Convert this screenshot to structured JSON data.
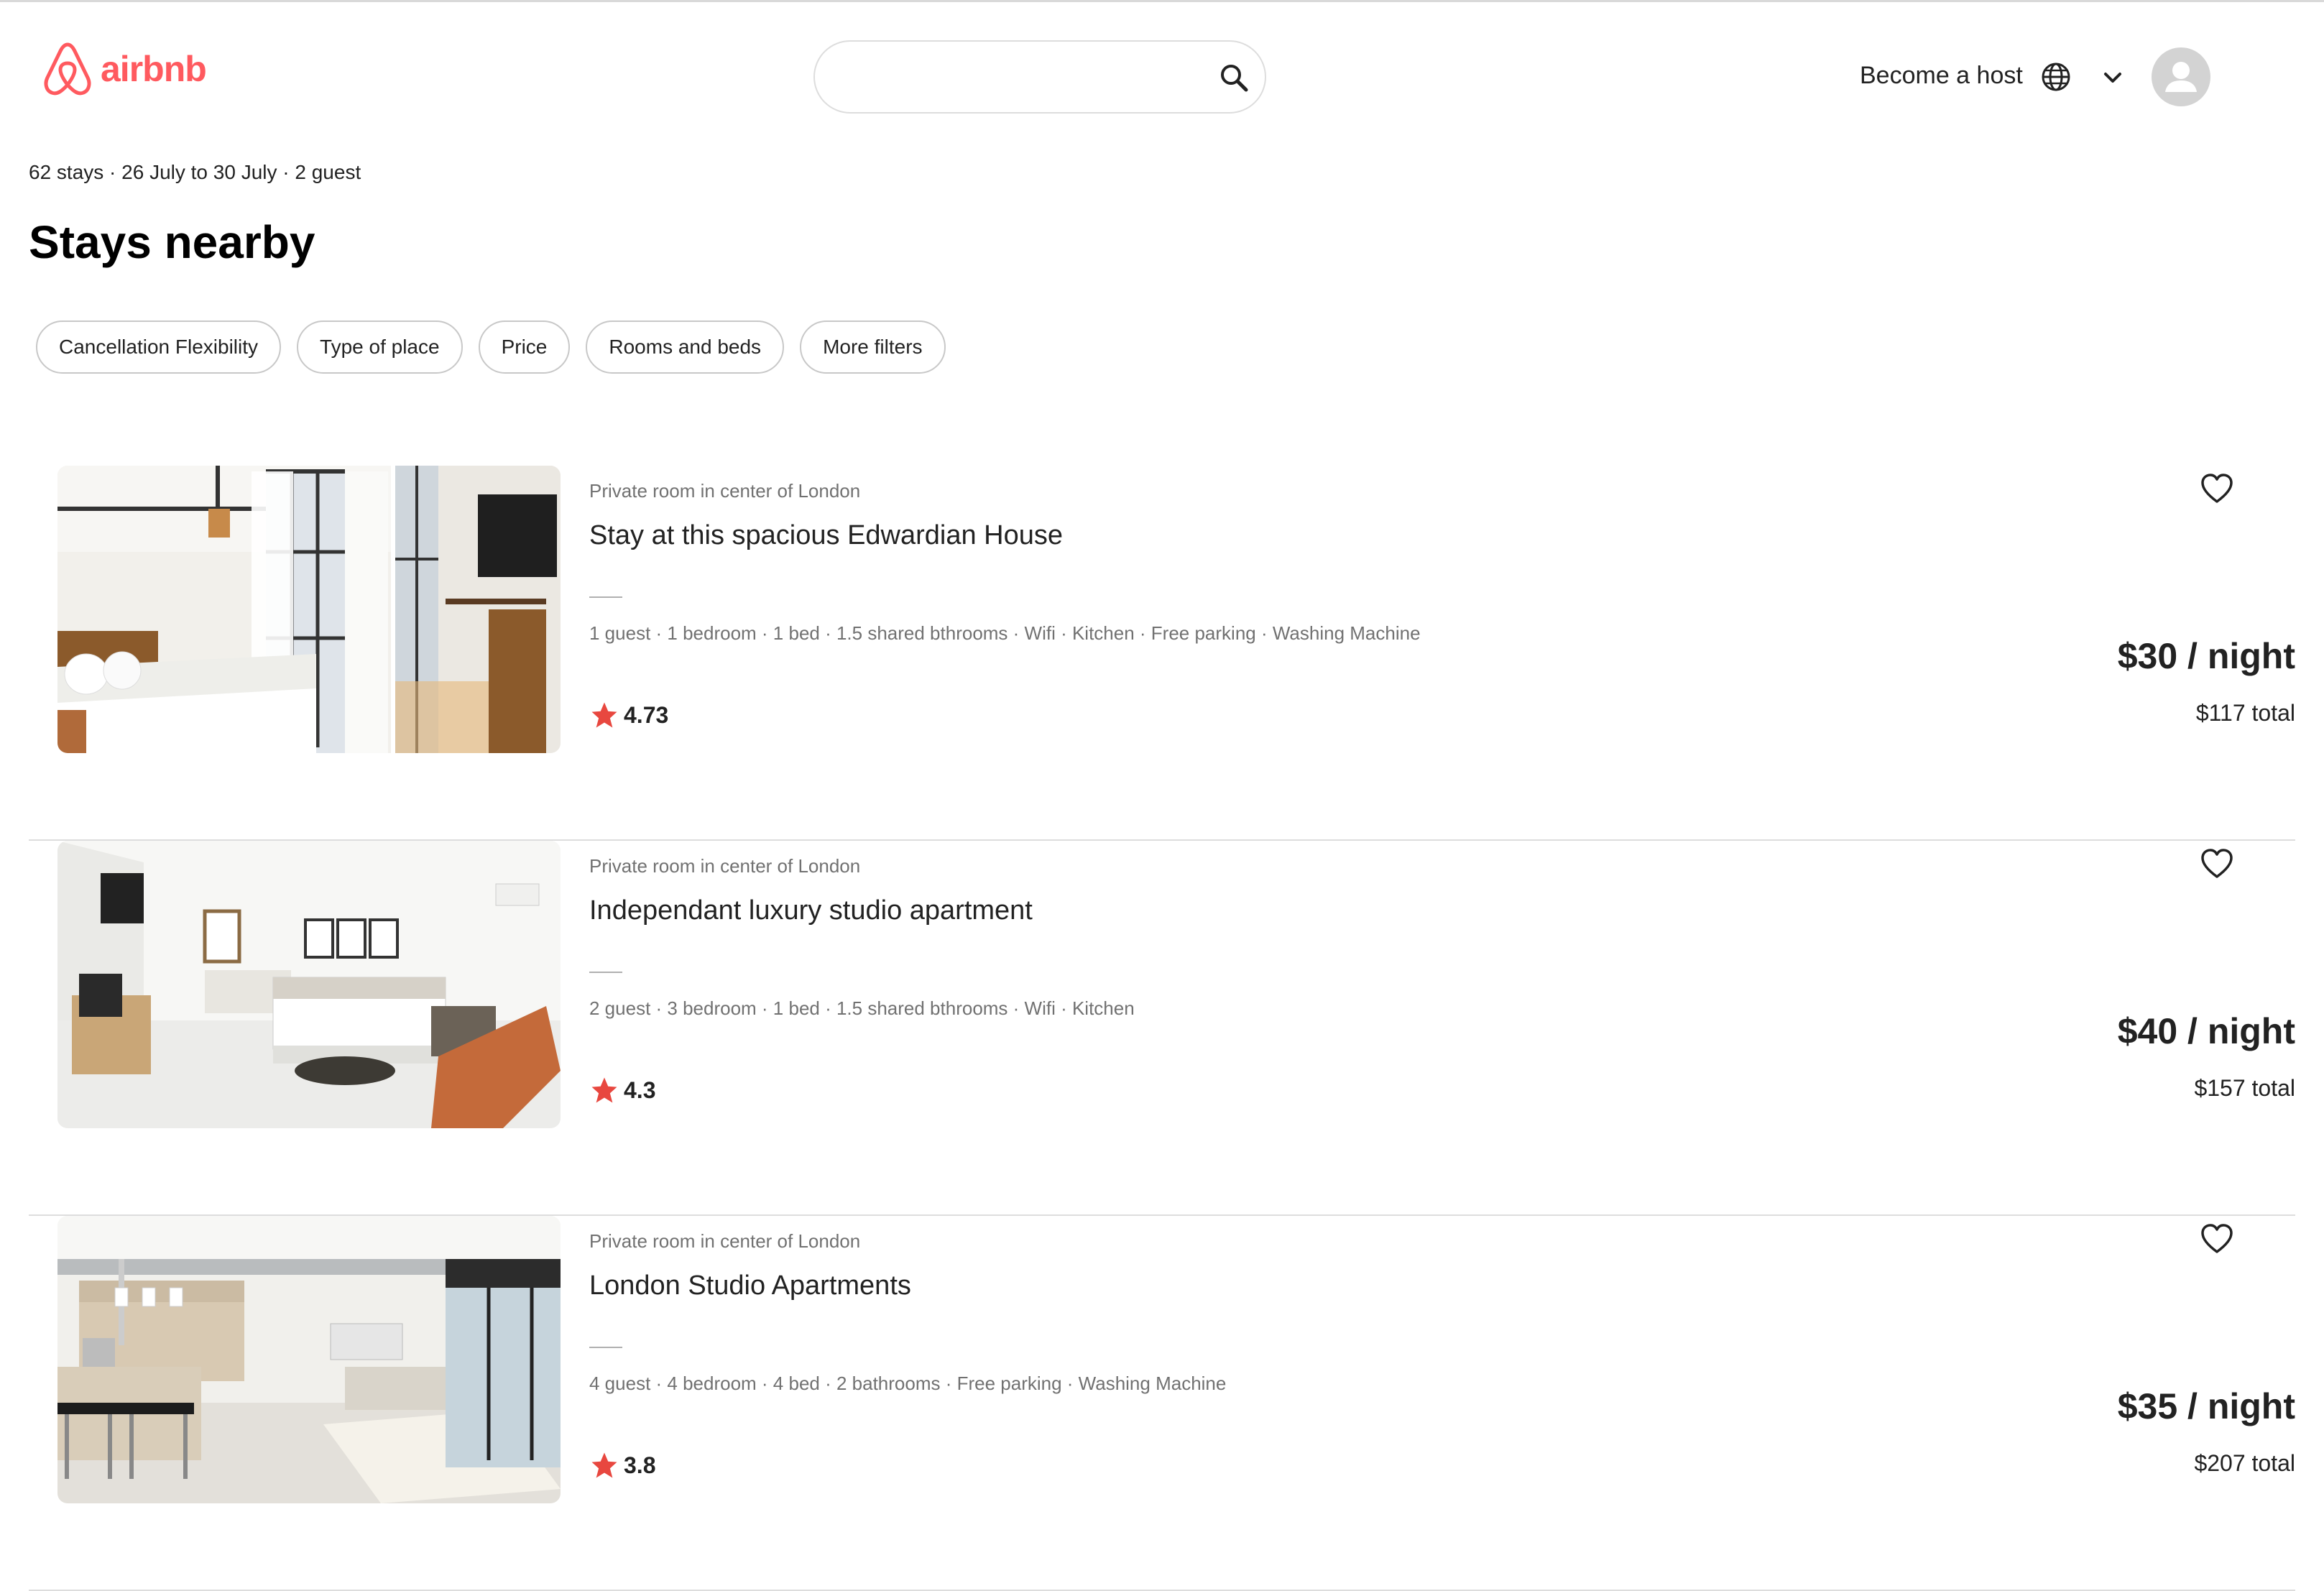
{
  "header": {
    "logo_text": "airbnb",
    "search_value": "",
    "host_label": "Become a host"
  },
  "colors": {
    "brand": "#FF5A5F",
    "star": "#E8473F"
  },
  "icons": [
    "search-icon",
    "globe-icon",
    "chevron-down-icon",
    "user-icon",
    "heart-icon",
    "star-icon"
  ],
  "summary": "62 stays · 26 July to 30 July · 2 guest",
  "page_title": "Stays nearby",
  "filters": [
    "Cancellation Flexibility",
    "Type of place",
    "Price",
    "Rooms and beds",
    "More filters"
  ],
  "listings": [
    {
      "type": "Private room in center of London",
      "title": "Stay at this spacious Edwardian House",
      "amenities": "1 guest · 1 bedroom · 1 bed · 1.5 shared bthrooms · Wifi · Kitchen · Free parking · Washing Machine",
      "rating": "4.73",
      "price": "$30 / night",
      "total": "$117 total"
    },
    {
      "type": "Private room in center of London",
      "title": "Independant luxury studio apartment",
      "amenities": "2 guest · 3 bedroom · 1 bed · 1.5 shared bthrooms · Wifi · Kitchen",
      "rating": "4.3",
      "price": "$40 / night",
      "total": "$157 total"
    },
    {
      "type": "Private room in center of London",
      "title": "London Studio Apartments",
      "amenities": "4 guest · 4 bedroom · 4 bed · 2 bathrooms · Free parking · Washing Machine",
      "rating": "3.8",
      "price": "$35 / night",
      "total": "$207 total"
    }
  ]
}
